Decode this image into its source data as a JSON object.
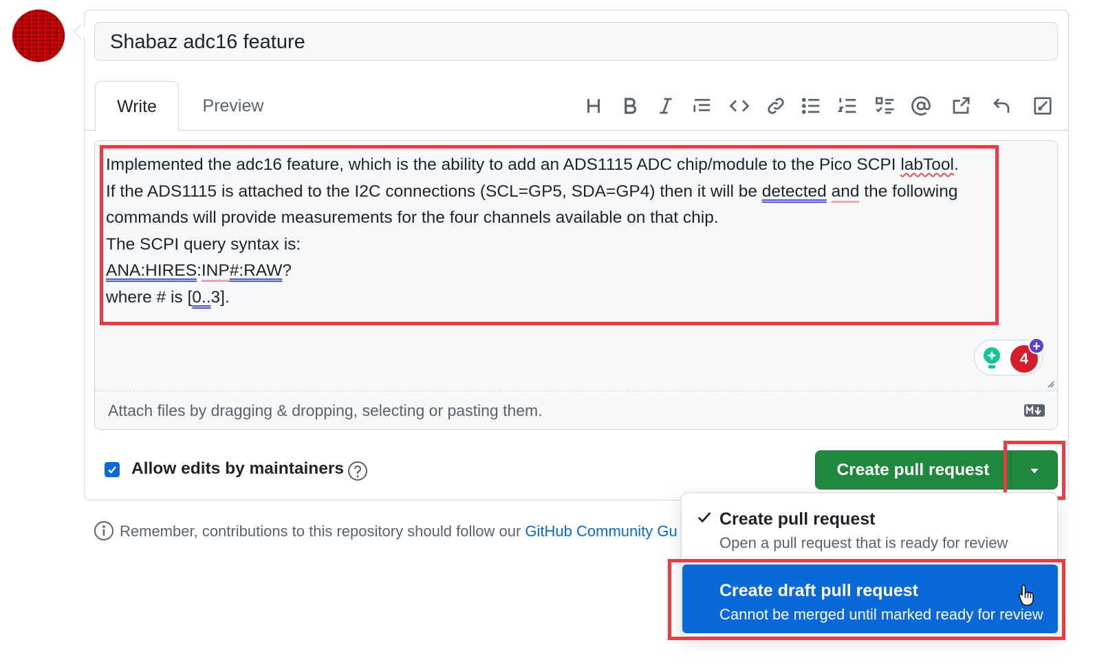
{
  "title_input": {
    "value": "Shabaz adc16 feature"
  },
  "tabs": [
    {
      "label": "Write"
    },
    {
      "label": "Preview"
    }
  ],
  "toolbar": {
    "icons": [
      "heading-icon",
      "bold-icon",
      "italic-icon",
      "quote-icon",
      "code-icon",
      "link-icon",
      "unordered-list-icon",
      "ordered-list-icon",
      "task-list-icon",
      "mention-icon",
      "reference-icon",
      "reply-icon",
      "fullscreen-icon"
    ]
  },
  "editor": {
    "line1_pre": "Implemented the adc16 feature, which is the ability to add an ADS1115 ADC chip/module to the Pico SCPI ",
    "line1_flag": "labTool",
    "line1_post": ".",
    "line2_pre": "If the ADS1115 is attached to the I2C connections (SCL=GP5, SDA=GP4) then it will be ",
    "line2_flag1": "detected",
    "line2_mid": " ",
    "line2_flag2": "and",
    "line2_post": " the following",
    "line3": "commands will provide measurements for the four channels available on that chip.",
    "line4": "The SCPI query syntax is:",
    "line5_a": "ANA:HIRES",
    "line5_b": ":",
    "line5_c": "INP",
    "line5_d": "#:RAW",
    "line5_e": "?",
    "line6_pre": "where # is [",
    "line6_flag": "0..",
    "line6_post": "3].",
    "attach_hint": "Attach files by dragging & dropping, selecting or pasting them.",
    "grammar_count": "4",
    "grammar_plus": "+"
  },
  "footer": {
    "allow_edits_label": "Allow edits by maintainers",
    "allow_edits_checked": true,
    "create_button_label": "Create pull request"
  },
  "reminder": {
    "text": "Remember, contributions to this repository should follow our ",
    "link": "GitHub Community Gu"
  },
  "dropdown": {
    "items": [
      {
        "title": "Create pull request",
        "description": "Open a pull request that is ready for review",
        "selected": true
      },
      {
        "title": "Create draft pull request",
        "description": "Cannot be merged until marked ready for review",
        "selected": false
      }
    ]
  },
  "colors": {
    "primary_green": "#1f883d",
    "accent_blue": "#0969da",
    "annotation_red": "#ec3b43"
  }
}
